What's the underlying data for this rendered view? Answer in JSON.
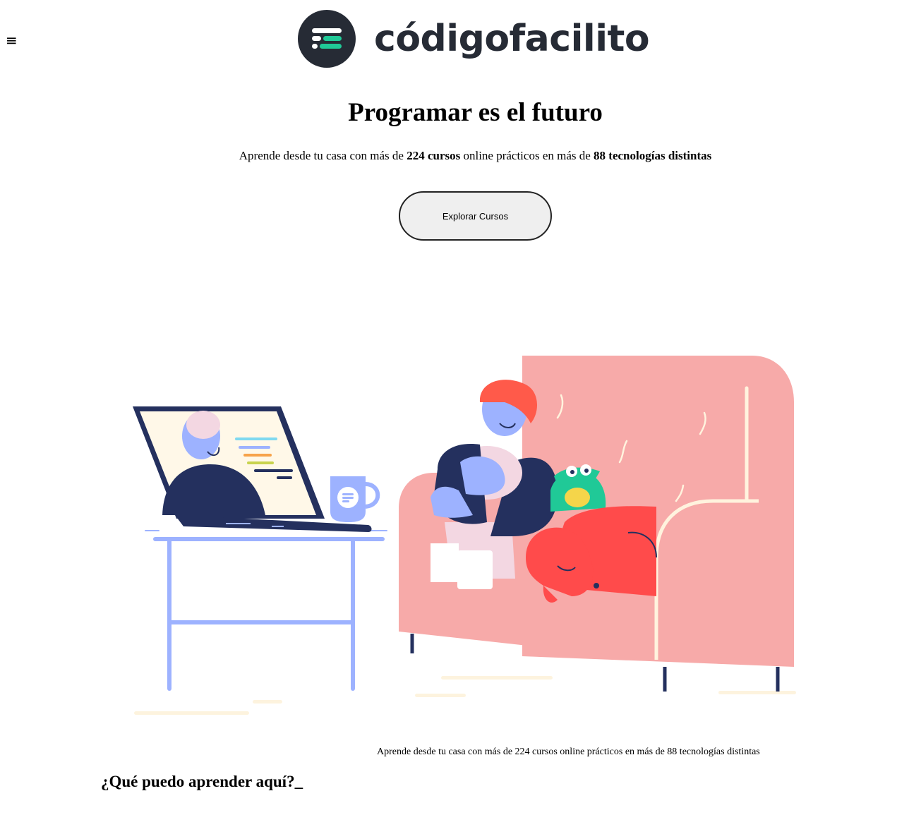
{
  "header": {
    "menu_icon": "≡",
    "brand_name": "códigofacilito"
  },
  "hero": {
    "title": "Programar es el futuro",
    "subtitle_parts": {
      "p1": "Aprende desde tu casa con más de ",
      "courses": "224 cursos",
      "p2": " online prácticos en más de ",
      "techs": "88 tecnologías distintas"
    },
    "cta_label": "Explorar Cursos"
  },
  "illustration": {
    "description_icon": "person-on-couch-with-laptop-illustration"
  },
  "caption": "Aprende desde tu casa con más de 224 cursos online prácticos en más de 88 tecnologías distintas",
  "section": {
    "title": "¿Qué puedo aprender aquí?_"
  },
  "colors": {
    "brand_dark": "#262b35",
    "brand_accent": "#20c997",
    "couch": "#f7aaa9",
    "dog": "#ff4b4b",
    "navy": "#24305e",
    "periwinkle": "#9db2ff"
  }
}
